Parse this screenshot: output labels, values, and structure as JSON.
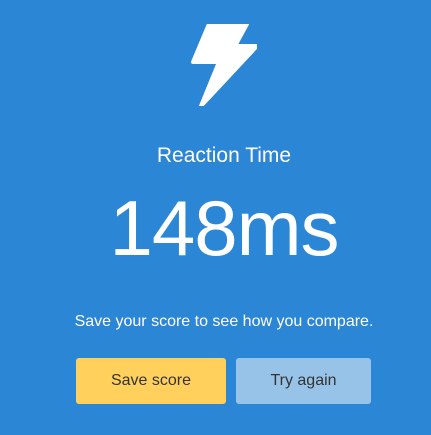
{
  "screen": {
    "icon": "lightning-bolt-icon",
    "title": "Reaction Time",
    "result": "148ms",
    "message": "Save your score to see how you compare."
  },
  "buttons": {
    "save_label": "Save score",
    "retry_label": "Try again"
  },
  "colors": {
    "background": "#2b86d5",
    "save_button": "#ffd15c",
    "retry_button": "#98c3e9",
    "text": "#ffffff"
  }
}
